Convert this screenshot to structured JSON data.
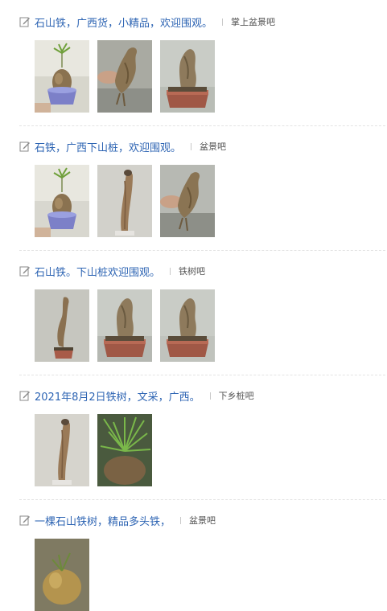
{
  "posts": [
    {
      "title": "石山铁，广西货，小精品，欢迎围观。",
      "forum": "掌上盆景吧",
      "images": [
        {
          "icon": "bonsai-pot-photo",
          "type": "pot",
          "bg": "#d7d6cc"
        },
        {
          "icon": "hand-root-photo",
          "type": "hand",
          "bg": "#a9aaa2"
        },
        {
          "icon": "potted-root-photo",
          "type": "potted",
          "bg": "#b9bdb6"
        }
      ]
    },
    {
      "title": "石铁，广西下山桩，欢迎围观。",
      "forum": "盆景吧",
      "images": [
        {
          "icon": "bonsai-pot-photo",
          "type": "pot",
          "bg": "#d8d7cf"
        },
        {
          "icon": "stick-root-photo",
          "type": "stick",
          "bg": "#d2d1cb"
        },
        {
          "icon": "hand-root-photo",
          "type": "hand",
          "bg": "#b7b9b3"
        }
      ]
    },
    {
      "title": "石山铁。下山桩欢迎围观。",
      "forum": "铁树吧",
      "images": [
        {
          "icon": "tall-root-photo",
          "type": "tall",
          "bg": "#c6c6bf"
        },
        {
          "icon": "potted-root-photo",
          "type": "potted",
          "bg": "#b5b8b2"
        },
        {
          "icon": "potted-root-photo",
          "type": "potted",
          "bg": "#c0c3bd"
        }
      ]
    },
    {
      "title": "2021年8月2日铁树，文采，广西。",
      "forum": "下乡桩吧",
      "images": [
        {
          "icon": "stick-root-photo",
          "type": "stick",
          "bg": "#d6d4cd"
        },
        {
          "icon": "green-plant-photo",
          "type": "plant",
          "bg": "#5f6e52"
        }
      ]
    },
    {
      "title": "一棵石山铁树，精品多头铁，",
      "forum": "盆景吧",
      "images": [
        {
          "icon": "dark-root-photo",
          "type": "dark",
          "bg": "#8f8a70"
        }
      ]
    }
  ],
  "colors": {
    "title_link": "#2d64b3",
    "forum_text": "#555555",
    "divider": "#e3e3e3"
  }
}
